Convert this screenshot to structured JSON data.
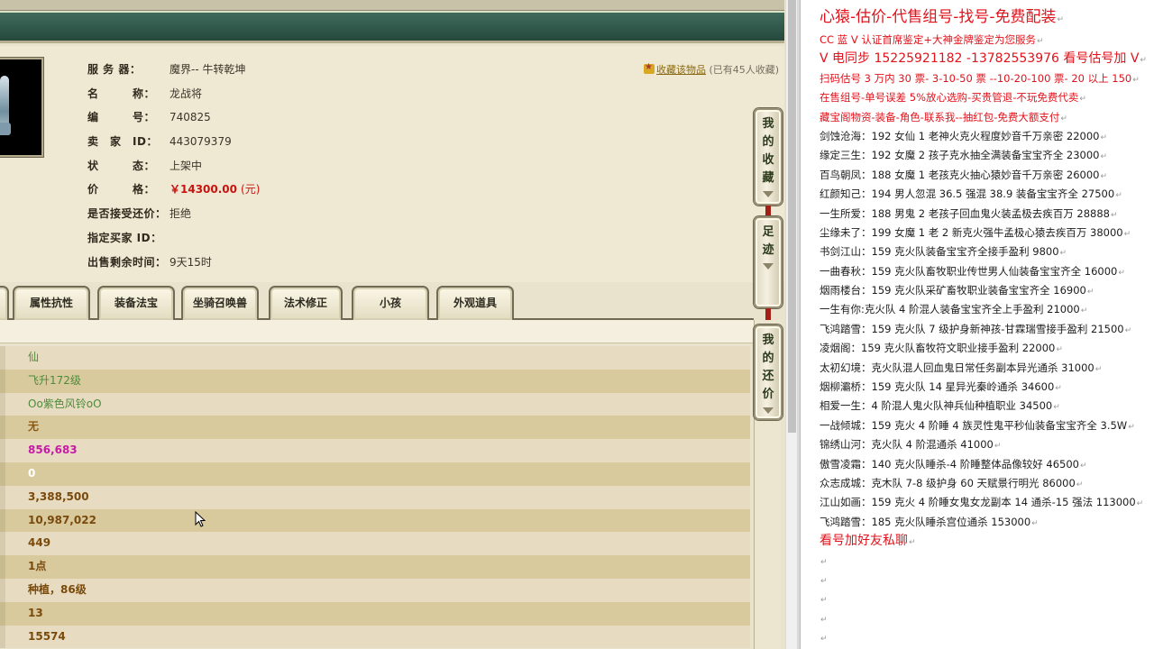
{
  "item": {
    "rows": [
      {
        "label": "服 务 器：",
        "value": "魔界-- 牛转乾坤"
      },
      {
        "label": "名　　　称：",
        "value": "龙战将"
      },
      {
        "label": "编　　　号：",
        "value": "740825"
      },
      {
        "label": "卖　家　ID：",
        "value": "443079379"
      },
      {
        "label": "状　　　态：",
        "value": "上架中"
      },
      {
        "label": "价　　　格：",
        "value": "￥14300.00"
      },
      {
        "label": "是否接受还价：",
        "value": "拒绝"
      },
      {
        "label": "指定买家 ID：",
        "value": ""
      },
      {
        "label": "出售剩余时间：",
        "value": "9天15时"
      }
    ],
    "price_unit": "(元)",
    "favorite": {
      "link": "收藏该物品",
      "count": "(已有45人收藏)"
    }
  },
  "side_buttons": {
    "favorites": [
      "我",
      "的",
      "收",
      "藏"
    ],
    "footprint": [
      "足",
      "迹"
    ],
    "counter_offer": [
      "我",
      "的",
      "还",
      "价"
    ]
  },
  "tabs": [
    "属性抗性",
    "装备法宝",
    "坐骑召唤兽",
    "法术修正",
    "小孩",
    "外观道具"
  ],
  "data_rows": [
    {
      "value": "仙",
      "color": "#4f8a3a",
      "bold": false
    },
    {
      "value": "飞升172级",
      "color": "#4f8a3a",
      "bold": false
    },
    {
      "value": "Oo紫色风铃oO",
      "color": "#4f8a3a",
      "bold": false
    },
    {
      "value": "无",
      "color": "#8a5a12",
      "bold": true
    },
    {
      "value": "856,683",
      "color": "#c71aa8",
      "bold": true
    },
    {
      "value": "0",
      "color": "#ffffff",
      "bold": true
    },
    {
      "value": "3,388,500",
      "color": "#7a4a0c",
      "bold": true
    },
    {
      "value": "10,987,022",
      "color": "#7a4a0c",
      "bold": true
    },
    {
      "value": "449",
      "color": "#7a4a0c",
      "bold": true
    },
    {
      "value": "1点",
      "color": "#7a4a0c",
      "bold": true
    },
    {
      "value": "种植，86级",
      "color": "#7a4a0c",
      "bold": true
    },
    {
      "value": "13",
      "color": "#7a4a0c",
      "bold": true
    },
    {
      "value": "15574",
      "color": "#7a4a0c",
      "bold": true
    }
  ],
  "notes": [
    {
      "text": "心猿-估价-代售组号-找号-免费配装",
      "style": "red big"
    },
    {
      "text": "CC 蓝 V 认证首席鉴定+大神金牌鉴定为您服务",
      "style": "red"
    },
    {
      "text": "V 电同步 15225921182 -13782553976 看号估号加 V",
      "style": "red mid"
    },
    {
      "text": "扫码估号 3 万内 30 票- 3-10-50 票 --10-20-100 票- 20 以上 150",
      "style": "red"
    },
    {
      "text": "在售组号-单号误差 5%放心选购-买贵管退-不玩免费代卖",
      "style": "red"
    },
    {
      "text": "藏宝阁物资-装备-角色-联系我--抽红包-免费大额支付",
      "style": "red"
    },
    {
      "text": "剑蚀沧海：192 女仙 1 老神火克火程度妙音千万亲密 22000",
      "style": ""
    },
    {
      "text": "缘定三生：192 女魔 2 孩子克水抽全满装备宝宝齐全 23000",
      "style": ""
    },
    {
      "text": "百鸟朝凤：188 女魔 1 老孩克火抽心猿妙音千万亲密 26000",
      "style": ""
    },
    {
      "text": "红颜知己：194 男人忽混 36.5 强混 38.9 装备宝宝齐全 27500",
      "style": ""
    },
    {
      "text": "一生所爱：188 男鬼 2 老孩子回血鬼火装孟极去疾百万 28888",
      "style": ""
    },
    {
      "text": "尘缘未了：199 女魔 1 老 2 新克火强牛孟极心猿去疾百万 38000",
      "style": ""
    },
    {
      "text": "书剑江山：159 克火队装备宝宝齐全接手盈利 9800",
      "style": ""
    },
    {
      "text": "一曲春秋：159 克火队畜牧职业传世男人仙装备宝宝齐全 16000",
      "style": ""
    },
    {
      "text": "烟雨楼台：159 克火队采矿畜牧职业装备宝宝齐全 16900",
      "style": ""
    },
    {
      "text": "一生有你:克火队 4 阶混人装备宝宝齐全上手盈利 21000",
      "style": ""
    },
    {
      "text": "飞鸿踏雪：159 克火队 7 级护身新神孩-甘霖瑞雪接手盈利 21500",
      "style": ""
    },
    {
      "text": "凌烟阁：159 克火队畜牧符文职业接手盈利 22000",
      "style": ""
    },
    {
      "text": "太初幻境：克火队混人回血鬼日常任务副本异光通杀 31000",
      "style": ""
    },
    {
      "text": "烟柳灞桥：159 克火队 14 星异光秦岭通杀 34600",
      "style": ""
    },
    {
      "text": "相爱一生：4 阶混人鬼火队神兵仙种植职业 34500",
      "style": ""
    },
    {
      "text": "一战倾城：159 克火 4 阶睡 4 族灵性鬼平秒仙装备宝宝齐全 3.5W",
      "style": ""
    },
    {
      "text": "锦绣山河：克火队 4 阶混通杀 41000",
      "style": ""
    },
    {
      "text": "傲雪凌霜：140 克火队睡杀-4 阶睡整体品像较好 46500",
      "style": ""
    },
    {
      "text": "众志成城：克木队 7-8 级护身 60 天赋景行明光 86000",
      "style": ""
    },
    {
      "text": "江山如画：159 克火 4 阶睡女鬼女龙副本 14 通杀-15 强法 113000",
      "style": ""
    },
    {
      "text": "飞鸿踏雪：185 克火队睡杀宫位通杀 153000",
      "style": ""
    },
    {
      "text": "看号加好友私聊",
      "style": "red mid"
    },
    {
      "text": "",
      "style": ""
    },
    {
      "text": "",
      "style": ""
    },
    {
      "text": "",
      "style": ""
    },
    {
      "text": "",
      "style": ""
    },
    {
      "text": "",
      "style": ""
    }
  ],
  "colors": {
    "accent_red": "#e1121b",
    "header_green": "#2f5a4a",
    "price_red": "#c8140f"
  }
}
